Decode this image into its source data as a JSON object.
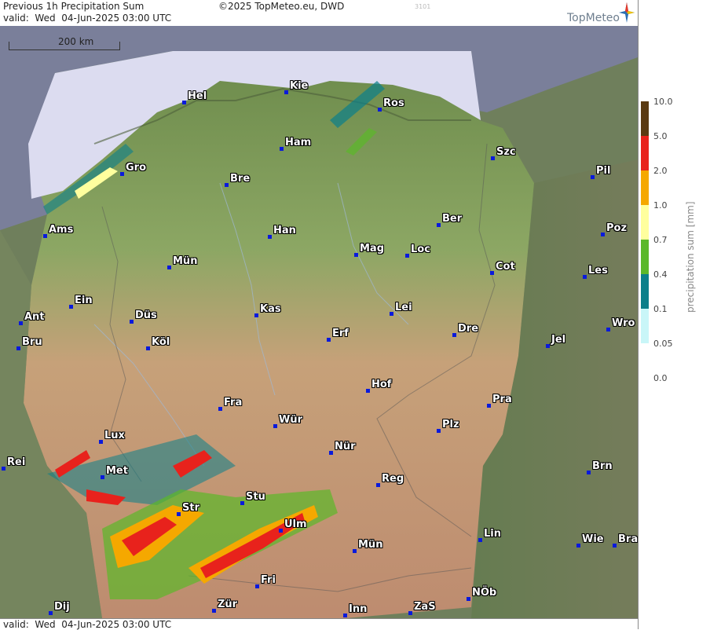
{
  "header": {
    "title": "Previous 1h Precipitation Sum",
    "copyright": "©2025 TopMeteo.eu, DWD",
    "code": "3101",
    "valid": "valid:  Wed  04-Jun-2025 03:00 UTC",
    "brand": "TopMeteo"
  },
  "footer": {
    "valid": "valid:  Wed  04-Jun-2025 03:00 UTC"
  },
  "map": {
    "scale_label": "200 km",
    "cities": [
      {
        "name": "Kie"
      },
      {
        "name": "Hel"
      },
      {
        "name": "Ros"
      },
      {
        "name": "Ham"
      },
      {
        "name": "Szc"
      },
      {
        "name": "Gro"
      },
      {
        "name": "Bre"
      },
      {
        "name": "Pil"
      },
      {
        "name": "Ber"
      },
      {
        "name": "Ams"
      },
      {
        "name": "Han"
      },
      {
        "name": "Poz"
      },
      {
        "name": "Mag"
      },
      {
        "name": "Loc"
      },
      {
        "name": "Mün"
      },
      {
        "name": "Cot"
      },
      {
        "name": "Les"
      },
      {
        "name": "Ein"
      },
      {
        "name": "Kas"
      },
      {
        "name": "Lei"
      },
      {
        "name": "Ant"
      },
      {
        "name": "Düs"
      },
      {
        "name": "Wro"
      },
      {
        "name": "Dre"
      },
      {
        "name": "Erf"
      },
      {
        "name": "Bru"
      },
      {
        "name": "Köl"
      },
      {
        "name": "Jel"
      },
      {
        "name": "Hof"
      },
      {
        "name": "Fra"
      },
      {
        "name": "Pra"
      },
      {
        "name": "Wür"
      },
      {
        "name": "Plz"
      },
      {
        "name": "Lux"
      },
      {
        "name": "Nür"
      },
      {
        "name": "Rei"
      },
      {
        "name": "Brn"
      },
      {
        "name": "Met"
      },
      {
        "name": "Reg"
      },
      {
        "name": "Stu"
      },
      {
        "name": "Str"
      },
      {
        "name": "Ulm"
      },
      {
        "name": "Lin"
      },
      {
        "name": "Wie"
      },
      {
        "name": "Bra"
      },
      {
        "name": "Mün"
      },
      {
        "name": "Fri"
      },
      {
        "name": "NÖb"
      },
      {
        "name": "Zür"
      },
      {
        "name": "Dij"
      },
      {
        "name": "Inn"
      },
      {
        "name": "ZaS"
      }
    ]
  },
  "legend": {
    "title": "precipitation sum [mm]",
    "ticks": [
      "10.0",
      "5.0",
      "2.0",
      "1.0",
      "0.7",
      "0.4",
      "0.1",
      "0.05",
      "0.0"
    ],
    "colors": [
      "#5a3a12",
      "#e8221c",
      "#f5a800",
      "#ffff9e",
      "#5bb82a",
      "#0b7f8a",
      "#c9f6f8"
    ]
  }
}
